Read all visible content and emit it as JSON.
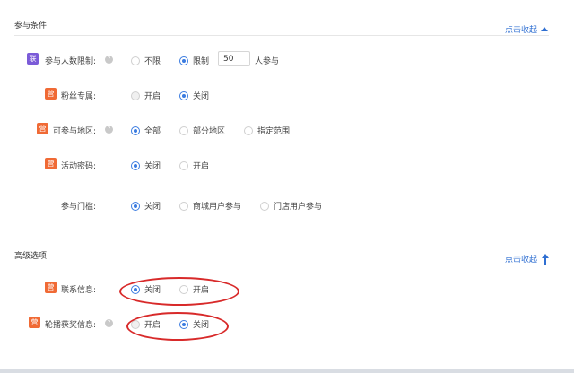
{
  "section1": {
    "title": "参与条件",
    "collapse_label": "点击收起"
  },
  "rows1": [
    {
      "badge": "联",
      "label": "参与人数限制:",
      "options": [
        "不限",
        "限制"
      ],
      "input_value": "50",
      "suffix": "人参与"
    },
    {
      "badge": "营",
      "label": "粉丝专属:",
      "options": [
        "开启",
        "关闭"
      ]
    },
    {
      "badge": "营",
      "label": "可参与地区:",
      "options": [
        "全部",
        "部分地区",
        "指定范围"
      ]
    },
    {
      "badge": "营",
      "label": "活动密码:",
      "options": [
        "关闭",
        "开启"
      ]
    },
    {
      "label": "参与门槛:",
      "options": [
        "关闭",
        "商城用户参与",
        "门店用户参与"
      ]
    }
  ],
  "section2": {
    "title": "高级选项",
    "collapse_label": "点击收起"
  },
  "rows2": [
    {
      "badge": "营",
      "label": "联系信息:",
      "options": [
        "关闭",
        "开启"
      ]
    },
    {
      "badge": "营",
      "label": "轮播获奖信息:",
      "options": [
        "开启",
        "关闭"
      ]
    }
  ],
  "colors": {
    "accent": "#3a7be0",
    "link": "#2f6fd2",
    "badge_purple": "#7b5bd8",
    "badge_orange": "#f06a35",
    "annotation": "#d82a2a"
  },
  "icons": {
    "help": "question-circle-icon",
    "collapse1": "caret-up-icon",
    "collapse2": "arrow-up-icon"
  }
}
